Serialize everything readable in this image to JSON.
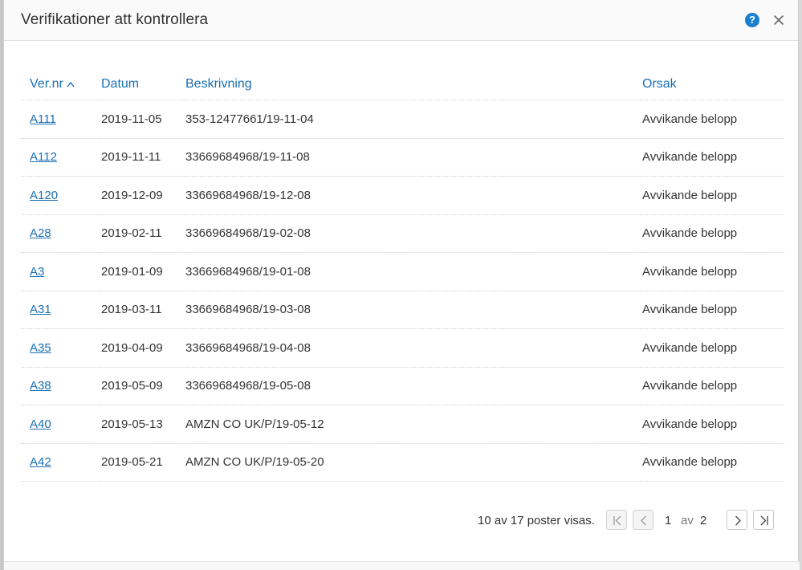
{
  "dialog": {
    "title": "Verifikationer att kontrollera",
    "help_label": "?"
  },
  "table": {
    "headers": {
      "vernr": "Ver.nr",
      "datum": "Datum",
      "beskrivning": "Beskrivning",
      "orsak": "Orsak"
    },
    "sort": {
      "column": "vernr",
      "direction": "ascending"
    },
    "rows": [
      {
        "vernr": "A111",
        "datum": "2019-11-05",
        "beskrivning": "353-12477661/19-11-04",
        "orsak": "Avvikande belopp"
      },
      {
        "vernr": "A112",
        "datum": "2019-11-11",
        "beskrivning": "33669684968/19-11-08",
        "orsak": "Avvikande belopp"
      },
      {
        "vernr": "A120",
        "datum": "2019-12-09",
        "beskrivning": "33669684968/19-12-08",
        "orsak": "Avvikande belopp"
      },
      {
        "vernr": "A28",
        "datum": "2019-02-11",
        "beskrivning": "33669684968/19-02-08",
        "orsak": "Avvikande belopp"
      },
      {
        "vernr": "A3",
        "datum": "2019-01-09",
        "beskrivning": "33669684968/19-01-08",
        "orsak": "Avvikande belopp"
      },
      {
        "vernr": "A31",
        "datum": "2019-03-11",
        "beskrivning": "33669684968/19-03-08",
        "orsak": "Avvikande belopp"
      },
      {
        "vernr": "A35",
        "datum": "2019-04-09",
        "beskrivning": "33669684968/19-04-08",
        "orsak": "Avvikande belopp"
      },
      {
        "vernr": "A38",
        "datum": "2019-05-09",
        "beskrivning": "33669684968/19-05-08",
        "orsak": "Avvikande belopp"
      },
      {
        "vernr": "A40",
        "datum": "2019-05-13",
        "beskrivning": "AMZN CO UK/P/19-05-12",
        "orsak": "Avvikande belopp"
      },
      {
        "vernr": "A42",
        "datum": "2019-05-21",
        "beskrivning": "AMZN CO UK/P/19-05-20",
        "orsak": "Avvikande belopp"
      }
    ]
  },
  "pagination": {
    "summary": "10 av 17 poster visas.",
    "current_page": "1",
    "of_label": "av",
    "total_pages": "2"
  },
  "colors": {
    "accent": "#1a6fb5",
    "help_icon": "#1a7fcf",
    "text": "#333333"
  }
}
